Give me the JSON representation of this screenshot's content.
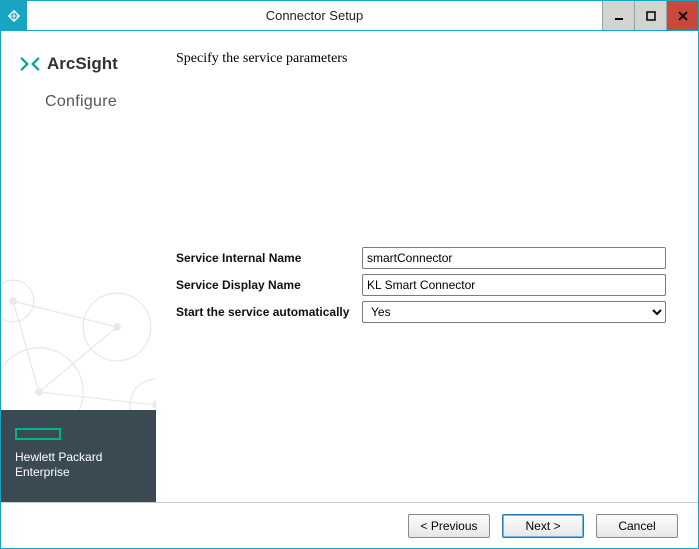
{
  "window": {
    "title": "Connector Setup"
  },
  "sidebar": {
    "brand": "ArcSight",
    "subhead": "Configure",
    "enterprise_line1": "Hewlett Packard",
    "enterprise_line2": "Enterprise"
  },
  "main": {
    "headline": "Specify the service parameters",
    "fields": {
      "internal_name_label": "Service Internal Name",
      "internal_name_value": "smartConnector",
      "display_name_label": "Service Display Name",
      "display_name_value": "KL Smart Connector",
      "autostart_label": "Start the service automatically",
      "autostart_value": "Yes"
    }
  },
  "buttons": {
    "previous": "< Previous",
    "next": "Next >",
    "cancel": "Cancel"
  }
}
